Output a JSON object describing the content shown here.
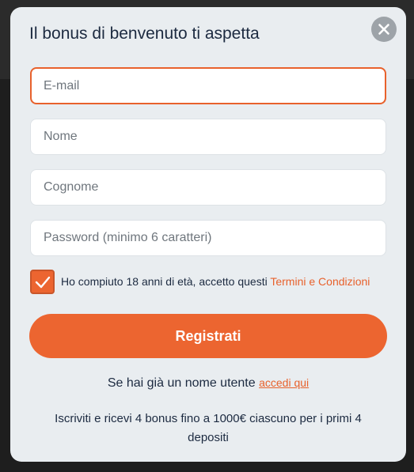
{
  "modal": {
    "title": "Il bonus di benvenuto ti aspetta",
    "close_icon": "close-icon"
  },
  "form": {
    "email_placeholder": "E-mail",
    "email_value": "",
    "name_placeholder": "Nome",
    "surname_placeholder": "Cognome",
    "password_placeholder": "Password (minimo 6 caratteri)",
    "consent_checked": true,
    "consent_text": "Ho compiuto 18 anni di età, accetto questi ",
    "consent_link": "Termini e Condizioni",
    "register_label": "Registrati"
  },
  "footer": {
    "login_prefix": "Se hai già un nome utente ",
    "login_link": "accedi qui",
    "bonus_text": "Iscriviti e ricevi 4 bonus fino a 1000€ ciascuno per i primi 4 depositi"
  },
  "colors": {
    "accent": "#ec6530",
    "text": "#1c2a40",
    "panel": "#e9edf0"
  }
}
